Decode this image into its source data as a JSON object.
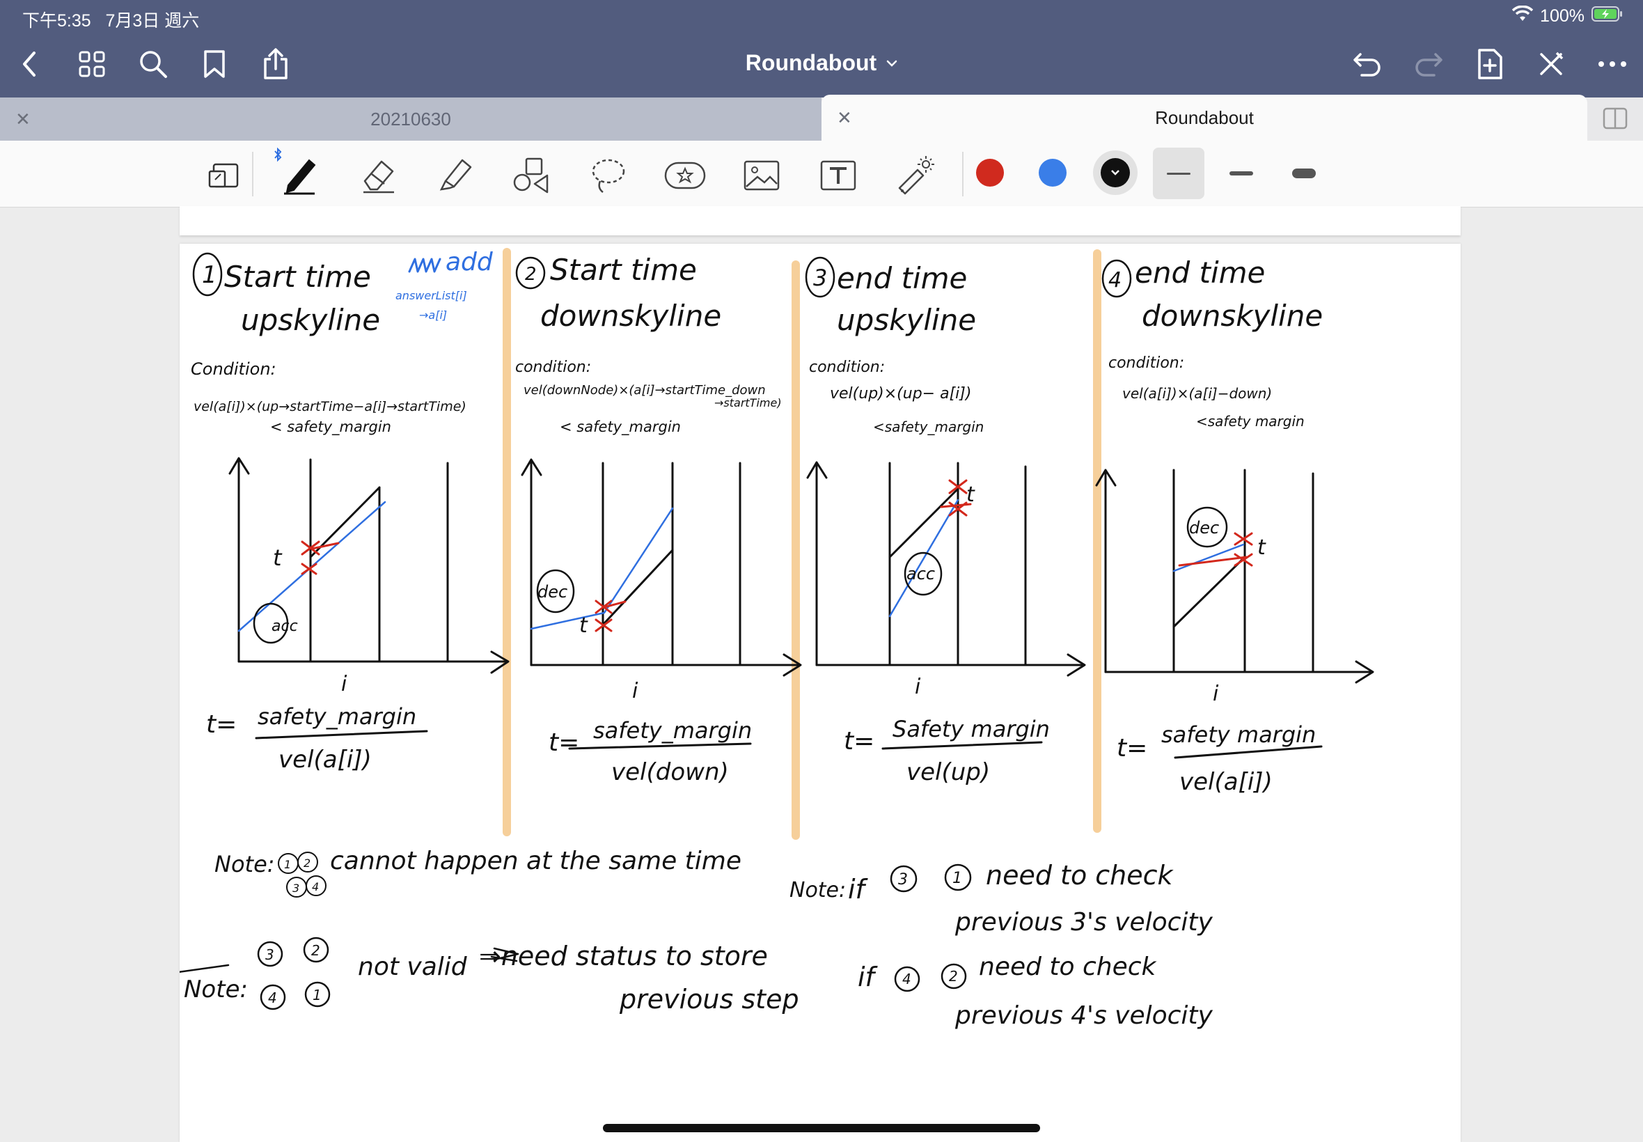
{
  "status": {
    "time": "下午5:35",
    "date": "7月3日 週六",
    "battery": "100%"
  },
  "nav": {
    "title": "Roundabout"
  },
  "tabs": [
    {
      "label": "20210630",
      "active": false
    },
    {
      "label": "Roundabout",
      "active": true
    }
  ],
  "toolbar": {
    "tools": [
      "zoom-window-icon",
      "pen-icon",
      "eraser-icon",
      "highlighter-icon",
      "shapes-icon",
      "lasso-icon",
      "sticker-icon",
      "image-icon",
      "text-icon",
      "laser-pointer-icon"
    ],
    "colors": [
      "#d02a1e",
      "#3a7ee8",
      "#111111"
    ],
    "stroke_widths": [
      "thin",
      "medium",
      "thick"
    ]
  },
  "notes": {
    "accent_blue": "#2f6fe0",
    "accent_red": "#d3281c",
    "divider_color": "#f6cf9a",
    "sections": [
      {
        "num": "1",
        "title1": "Start time",
        "title2": "upskyline",
        "cond_label": "Condition:",
        "cond1": "vel(a[i])×(up→startTime−a[i]→startTime)",
        "cond2": "< safety_margin",
        "axis_label": "i",
        "f_num": "safety_margin",
        "f_den": "vel(a[i])",
        "f_lhs": "t=",
        "acc_label": "acc",
        "t_label": "t"
      },
      {
        "num": "2",
        "title1": "Start time",
        "title2": "downskyline",
        "cond_label": "condition:",
        "cond1": "vel(downNode)×(a[i]→startTime_down",
        "cond1b": "→startTime)",
        "cond2": "< safety_margin",
        "axis_label": "i",
        "f_num": "safety_margin",
        "f_den": "vel(down)",
        "f_lhs": "t=",
        "acc_label": "dec",
        "t_label": "t"
      },
      {
        "num": "3",
        "title1": "end time",
        "title2": "upskyline",
        "cond_label": "condition:",
        "cond1": "vel(up)×(up− a[i])",
        "cond2": "<safety_margin",
        "axis_label": "i",
        "f_num": "Safety margin",
        "f_den": "vel(up)",
        "f_lhs": "t=",
        "acc_label": "acc",
        "t_label": "t"
      },
      {
        "num": "4",
        "title1": "end time",
        "title2": "downskyline",
        "cond_label": "condition:",
        "cond1": "vel(a[i])×(a[i]−down)",
        "cond2": "<safety margin",
        "axis_label": "i",
        "f_num": "safety margin",
        "f_den": "vel(a[i])",
        "f_lhs": "t=",
        "acc_label": "dec",
        "t_label": "t"
      }
    ],
    "blue_note": {
      "add": "add",
      "line1": "answerList[i]",
      "line2": "→a[i]"
    },
    "note1": {
      "label": "Note:",
      "text": "cannot happen at the same time",
      "c1": "1",
      "c2": "2",
      "c3": "3",
      "c4": "4"
    },
    "note2": {
      "label": "Note:",
      "c1": "3",
      "c2": "2",
      "c3": "4",
      "c4": "1",
      "not_valid": "not valid",
      "need": "⇒need status to store",
      "prev": "previous step"
    },
    "note3": {
      "label": "Note:",
      "if1": "if",
      "a1": "3",
      "b1": "1",
      "need1": "need to check",
      "prev1": "previous 3's velocity",
      "if2": "if",
      "a2": "4",
      "b2": "2",
      "need2": "need to check",
      "prev2": "previous 4's velocity"
    }
  }
}
